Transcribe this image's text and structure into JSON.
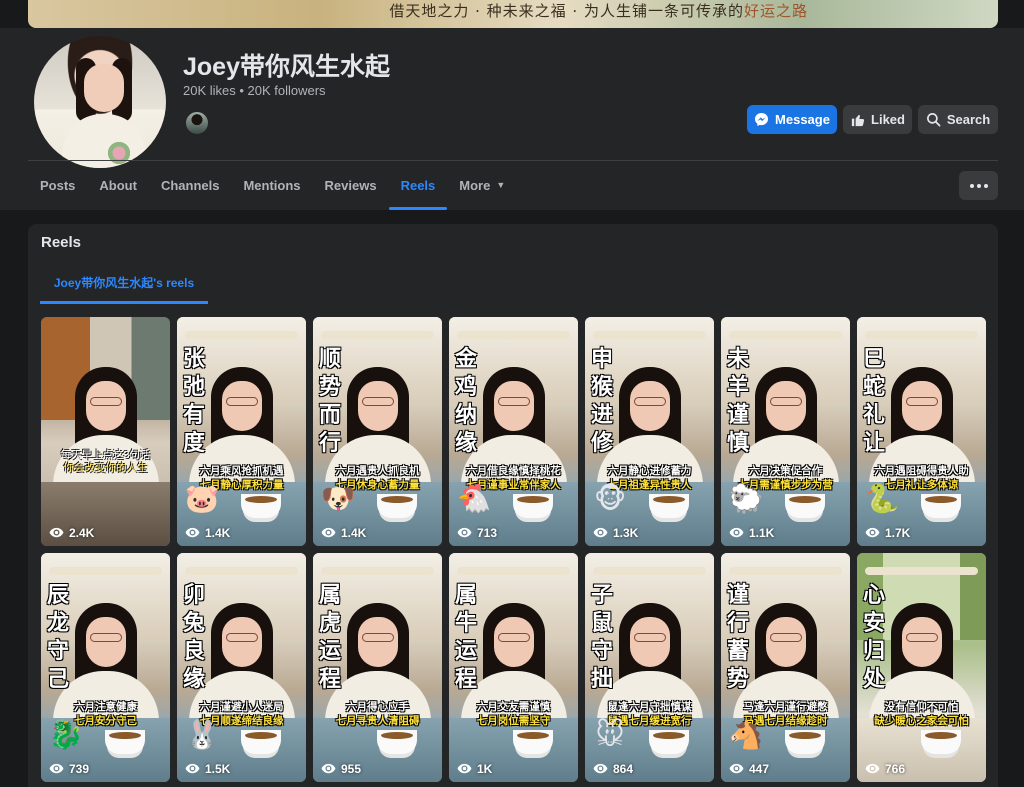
{
  "cover": {
    "banner_text_a": "借天地之力 · 种未来之福 · 为人生铺一条可传承的",
    "banner_text_b": "好运之路"
  },
  "page": {
    "name": "Joey带你风生水起",
    "stats": "20K likes • 20K followers"
  },
  "actions": {
    "message": "Message",
    "liked": "Liked",
    "search": "Search"
  },
  "tabs": [
    {
      "label": "Posts"
    },
    {
      "label": "About"
    },
    {
      "label": "Channels"
    },
    {
      "label": "Mentions"
    },
    {
      "label": "Reviews"
    },
    {
      "label": "Reels"
    },
    {
      "label": "More"
    }
  ],
  "active_tab": "Reels",
  "reels": {
    "title": "Reels",
    "subtab": "Joey带你风生水起's reels",
    "items": [
      {
        "big": "",
        "cap1": "每天早上点这3句话",
        "cap2": "你会改变你的人生",
        "badge": "",
        "views": "2.4K"
      },
      {
        "big": "张弛有度",
        "cap1": "六月乘风抢抓机遇",
        "cap2": "七月静心厚积力量",
        "badge": "🐷",
        "views": "1.4K"
      },
      {
        "big": "顺势而行",
        "cap1": "六月遇贵人抓良机",
        "cap2": "七月休身心蓄力量",
        "badge": "🐶",
        "views": "1.4K"
      },
      {
        "big": "金鸡纳缘",
        "cap1": "六月借良缘慎择桃花",
        "cap2": "七月谨事业常伴家人",
        "badge": "🐔",
        "views": "713"
      },
      {
        "big": "申猴进修",
        "cap1": "六月静心进修蓄力",
        "cap2": "七月祖逢异性贵人",
        "badge": "🐵",
        "views": "1.3K"
      },
      {
        "big": "未羊谨慎",
        "cap1": "六月决策促合作",
        "cap2": "七月需谨慎步步为营",
        "badge": "🐑",
        "views": "1.1K"
      },
      {
        "big": "巳蛇礼让",
        "cap1": "六月遇阻碍得贵人助",
        "cap2": "七月礼让多体谅",
        "badge": "🐍",
        "views": "1.7K"
      },
      {
        "big": "辰龙守己",
        "cap1": "六月注意健康",
        "cap2": "七月安分守己",
        "badge": "🐉",
        "views": "739"
      },
      {
        "big": "卯兔良缘",
        "cap1": "六月谨避小人迷局",
        "cap2": "七月顺遂缔结良缘",
        "badge": "🐰",
        "views": "1.5K"
      },
      {
        "big": "属虎运程",
        "cap1": "六月得心应手",
        "cap2": "七月寻贵人清阻碍",
        "badge": "",
        "views": "955"
      },
      {
        "big": "属牛运程",
        "cap1": "六月交友需谨慎",
        "cap2": "七月岗位需坚守",
        "badge": "",
        "views": "1K"
      },
      {
        "big": "子鼠守拙",
        "cap1": "鼠逢六月守拙慎谋",
        "cap2": "鼠遇七月缓进宽行",
        "badge": "🐭",
        "views": "864"
      },
      {
        "big": "谨行蓄势",
        "cap1": "马逢六月谨行避憋",
        "cap2": "马遇七月结缘趁时",
        "badge": "🐴",
        "views": "447"
      },
      {
        "big": "心安归处",
        "cap1": "没有信仰不可怕",
        "cap2": "缺少暖心之家会可怕",
        "badge": "",
        "views": "766"
      }
    ]
  },
  "colors": {
    "accent": "#2d88ff",
    "message_btn": "#1b74e4",
    "bg": "#18191a",
    "card": "#242526"
  }
}
